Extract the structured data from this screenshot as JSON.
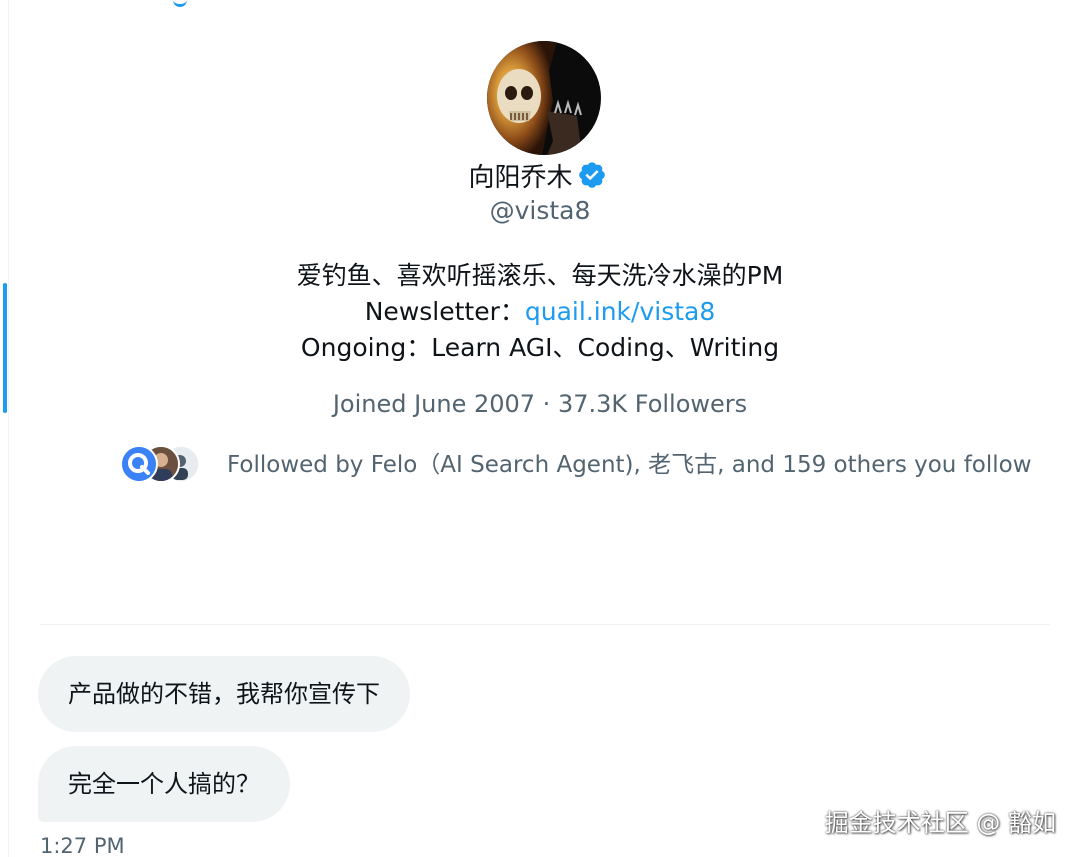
{
  "profile": {
    "name": "向阳乔木",
    "handle": "@vista8",
    "verified_icon": "verified-badge-icon",
    "bio": {
      "line1": "爱钓鱼、喜欢听摇滚乐、每天洗冷水澡的PM",
      "newsletter_label": "Newsletter：",
      "newsletter_link": "quail.ink/vista8",
      "line3": "Ongoing：Learn AGI、Coding、Writing"
    },
    "meta": "Joined June 2007 · 37.3K Followers",
    "followed_by": "Followed by Felo（AI Search Agent), 老飞古, and 159 others you follow"
  },
  "messages": [
    {
      "text": "产品做的不错，我帮你宣传下"
    },
    {
      "text": "完全一个人搞的？"
    }
  ],
  "timestamp": "1:27 PM",
  "watermark": "掘金技术社区 @ 豁如",
  "colors": {
    "accent": "#1d9bf0",
    "text": "#0f1419",
    "secondary": "#536471",
    "bubble": "#eff3f4"
  }
}
